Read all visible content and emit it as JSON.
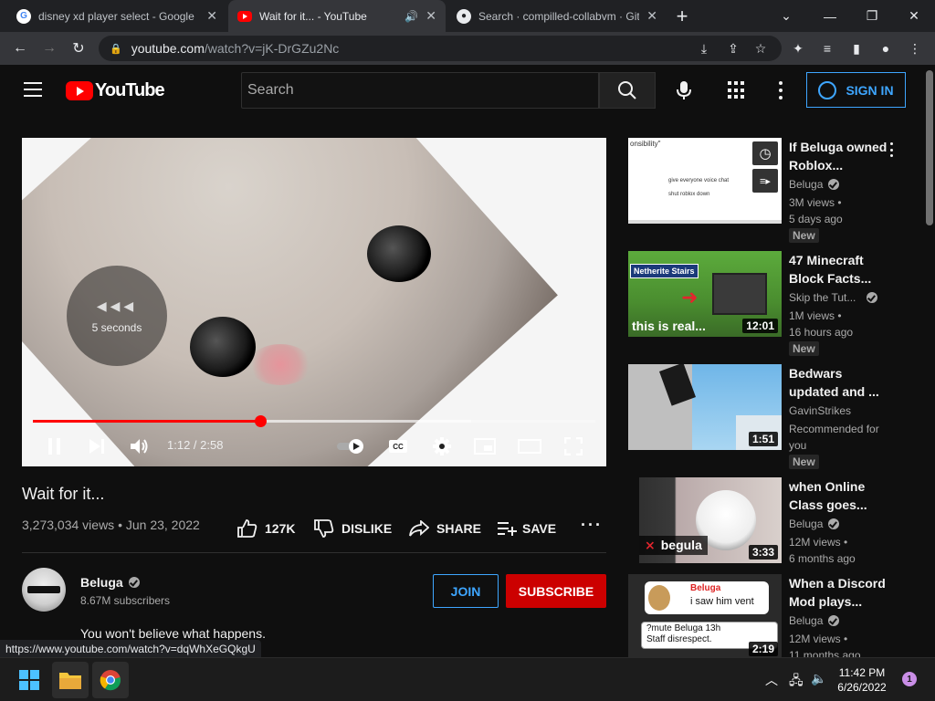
{
  "browser": {
    "tabs": [
      {
        "title": "disney xd player select - Google",
        "favicon": "google-icon"
      },
      {
        "title": "Wait for it... - YouTube",
        "favicon": "youtube-icon",
        "active": true
      },
      {
        "title": "Search · compilled-collabvm · Git",
        "favicon": "github-icon"
      }
    ],
    "url_host": "youtube.com",
    "url_path": "/watch?v=jK-DrGZu2Nc",
    "status_url": "https://www.youtube.com/watch?v=dqWhXeGQkgU"
  },
  "youtube": {
    "logo_text": "YouTube",
    "search_placeholder": "Search",
    "sign_in": "SIGN IN",
    "accent": "#ff0000",
    "link_color": "#3ea6ff"
  },
  "player": {
    "seek_hint": "5 seconds",
    "time": "1:12 / 2:58",
    "progress": 0.4045,
    "buffered": 0.78
  },
  "video": {
    "title": "Wait for it...",
    "meta": "3,273,034 views • Jun 23, 2022",
    "likes": "127K",
    "dislike": "DISLIKE",
    "share": "SHARE",
    "save": "SAVE",
    "channel": "Beluga",
    "subscribers": "8.67M subscribers",
    "join": "JOIN",
    "subscribe": "SUBSCRIBE",
    "description": "You won't believe what happens."
  },
  "recommendations": [
    {
      "title": "If Beluga owned Roblox...",
      "channel": "Beluga",
      "verified": true,
      "line1": "3M views •",
      "line2": "5 days ago",
      "badge": "New",
      "duration": "",
      "thumb_text": [
        "onsibility\"",
        "give everyone voice chat",
        "shut roblox down"
      ]
    },
    {
      "title": "47 Minecraft Block Facts...",
      "channel": "Skip the Tut...",
      "verified": true,
      "line1": "1M views •",
      "line2": "16 hours ago",
      "badge": "New",
      "duration": "12:01",
      "thumb_text": [
        "Netherite Stairs",
        "this is real..."
      ]
    },
    {
      "title": "Bedwars updated and ...",
      "channel": "GavinStrikes",
      "verified": false,
      "line1": "Recommended for",
      "line2": "you",
      "badge": "New",
      "duration": "1:51",
      "thumb_text": []
    },
    {
      "title": "when Online Class goes...",
      "channel": "Beluga",
      "verified": true,
      "line1": "12M views •",
      "line2": "6 months ago",
      "badge": "",
      "duration": "3:33",
      "thumb_text": [
        "begula"
      ]
    },
    {
      "title": "When a Discord Mod plays...",
      "channel": "Beluga",
      "verified": true,
      "line1": "12M views •",
      "line2": "11 months ago",
      "badge": "",
      "duration": "2:19",
      "thumb_text": [
        "Beluga",
        "i saw him vent",
        "?mute Beluga 13h",
        "Staff disrespect."
      ]
    }
  ],
  "taskbar": {
    "time": "11:42 PM",
    "date": "6/26/2022",
    "notifications": "1"
  }
}
